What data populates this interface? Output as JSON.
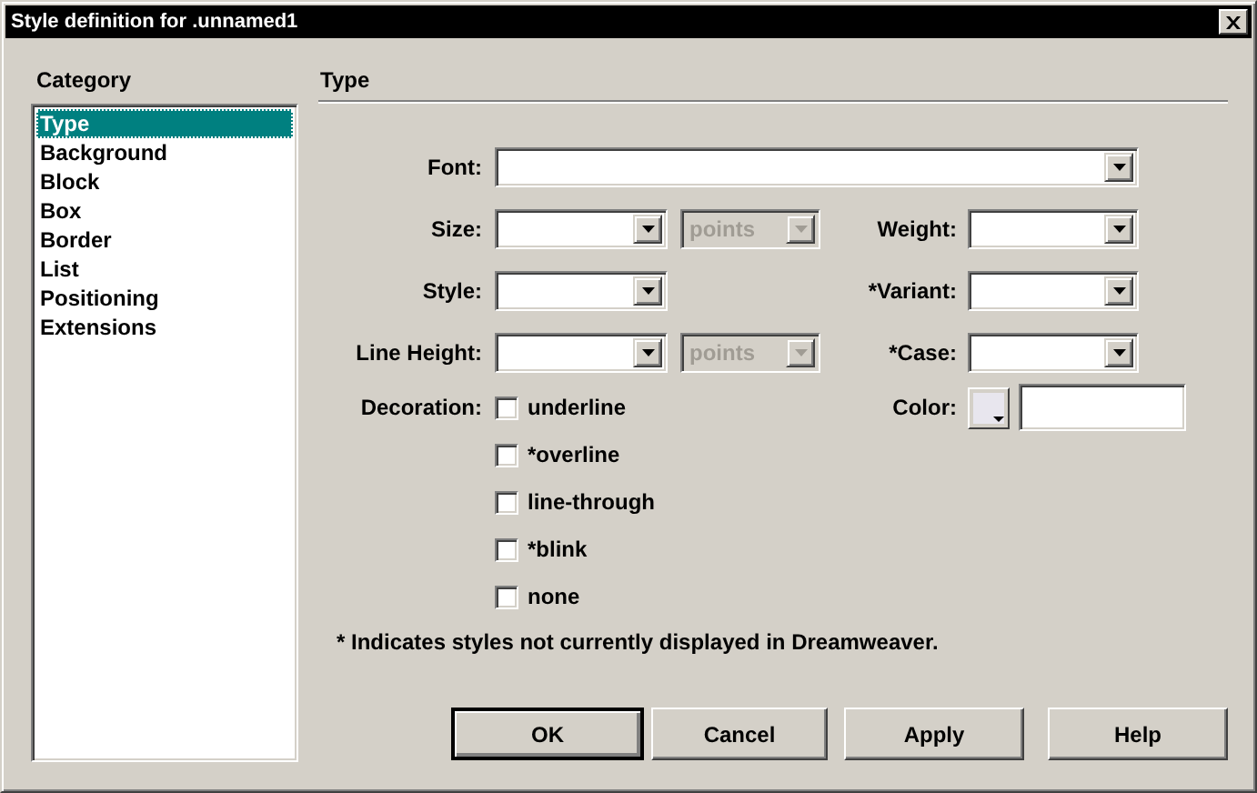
{
  "window": {
    "title": "Style definition for .unnamed1"
  },
  "category": {
    "label": "Category",
    "items": [
      {
        "label": "Type",
        "selected": true
      },
      {
        "label": "Background",
        "selected": false
      },
      {
        "label": "Block",
        "selected": false
      },
      {
        "label": "Box",
        "selected": false
      },
      {
        "label": "Border",
        "selected": false
      },
      {
        "label": "List",
        "selected": false
      },
      {
        "label": "Positioning",
        "selected": false
      },
      {
        "label": "Extensions",
        "selected": false
      }
    ]
  },
  "panel": {
    "title": "Type"
  },
  "font": {
    "label": "Font:"
  },
  "size": {
    "label": "Size:",
    "unit": {
      "value": "points",
      "disabled": true
    }
  },
  "weight": {
    "label": "Weight:"
  },
  "style": {
    "label": "Style:"
  },
  "variant": {
    "label": "*Variant:"
  },
  "line_height": {
    "label": "Line Height:",
    "unit": {
      "value": "points",
      "disabled": true
    }
  },
  "case": {
    "label": "*Case:"
  },
  "decoration": {
    "label": "Decoration:",
    "options": [
      {
        "label": "underline",
        "checked": false
      },
      {
        "label": "*overline",
        "checked": false
      },
      {
        "label": "line-through",
        "checked": false
      },
      {
        "label": "*blink",
        "checked": false
      },
      {
        "label": "none",
        "checked": false
      }
    ]
  },
  "color": {
    "label": "Color:"
  },
  "note": "* Indicates styles not currently displayed in Dreamweaver.",
  "buttons": [
    {
      "label": "OK",
      "default": true
    },
    {
      "label": "Cancel",
      "default": false
    },
    {
      "label": "Apply",
      "default": false
    },
    {
      "label": "Help",
      "default": false
    }
  ]
}
